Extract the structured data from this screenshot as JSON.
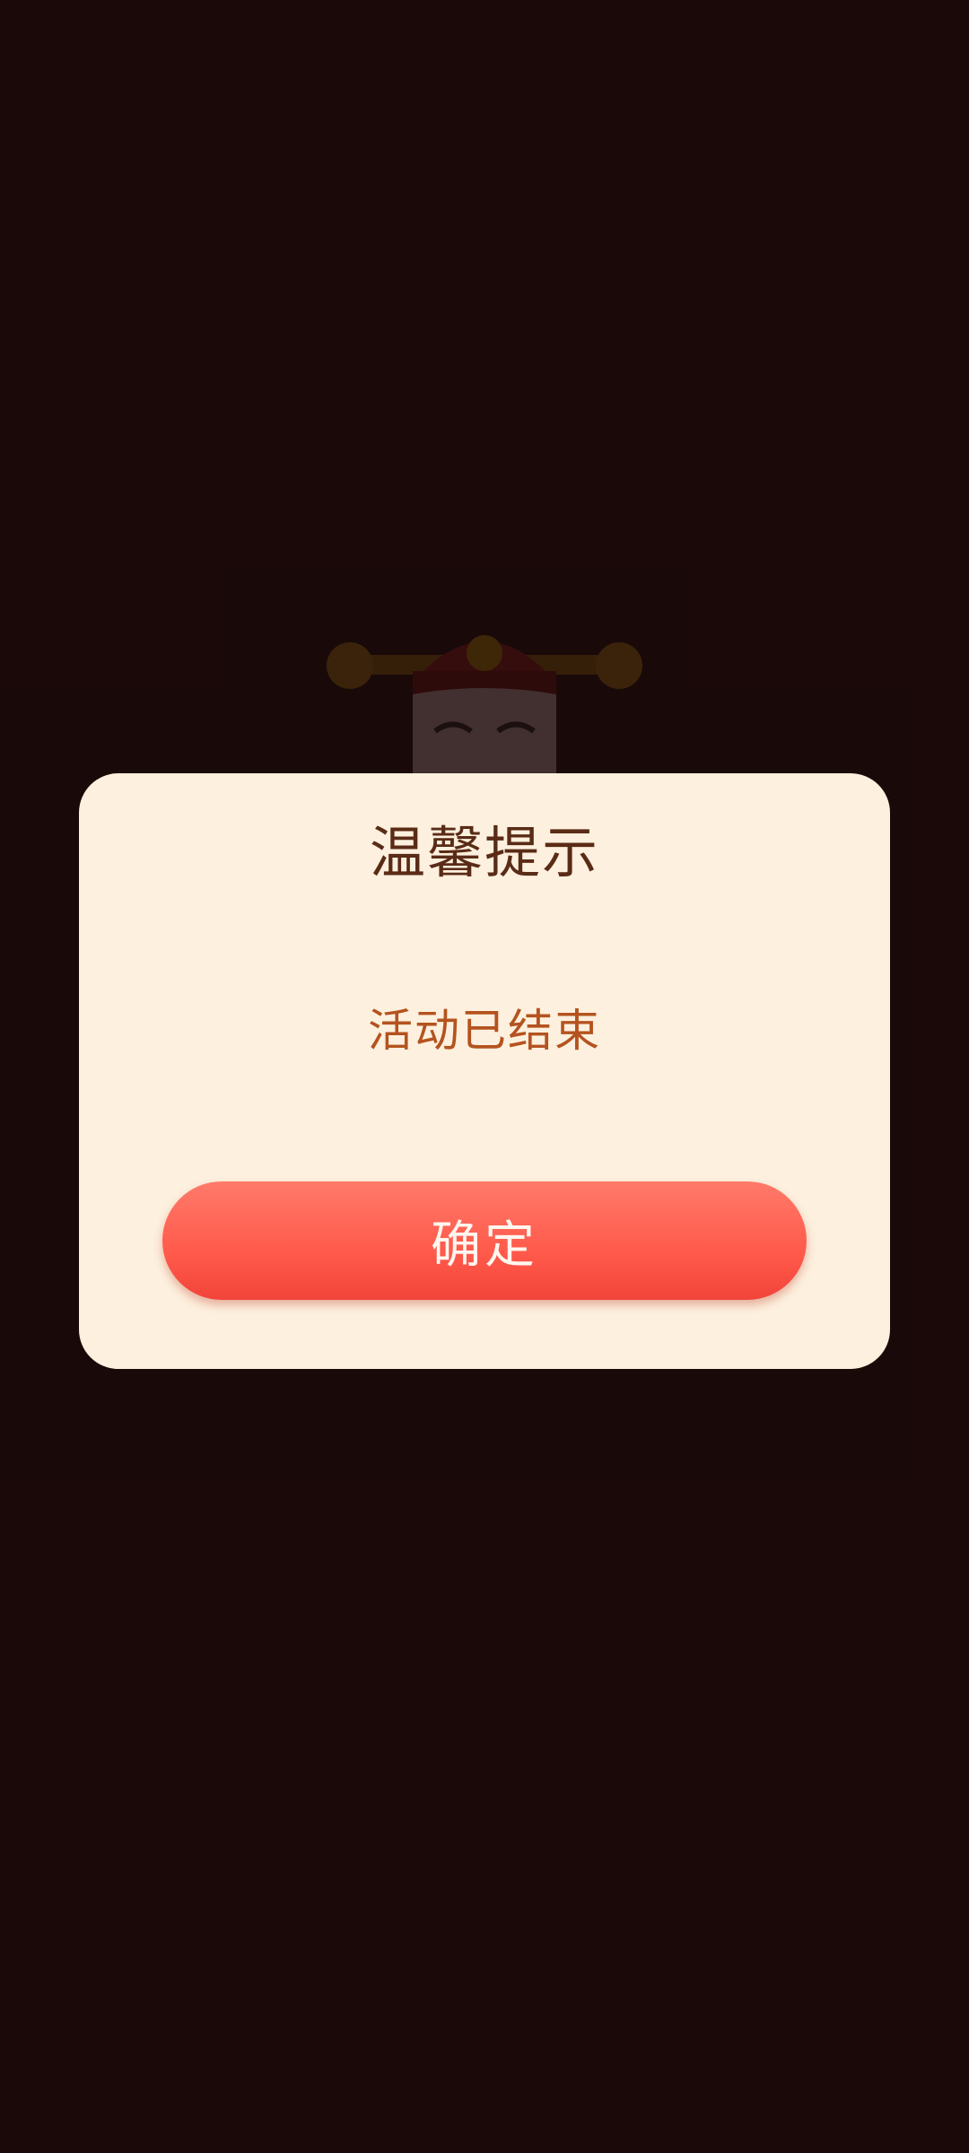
{
  "dialog": {
    "title": "温馨提示",
    "message": "活动已结束",
    "confirm_label": "确定"
  },
  "background": {
    "illustration": "god-of-wealth-figure"
  },
  "colors": {
    "screen_background": "#1e0b0c",
    "dialog_background": "#fdf0de",
    "title_text": "#5a2b16",
    "message_text": "#b4531f",
    "button_top": "#ff7a6a",
    "button_bottom": "#f2443a",
    "button_text": "#fff6ef"
  }
}
